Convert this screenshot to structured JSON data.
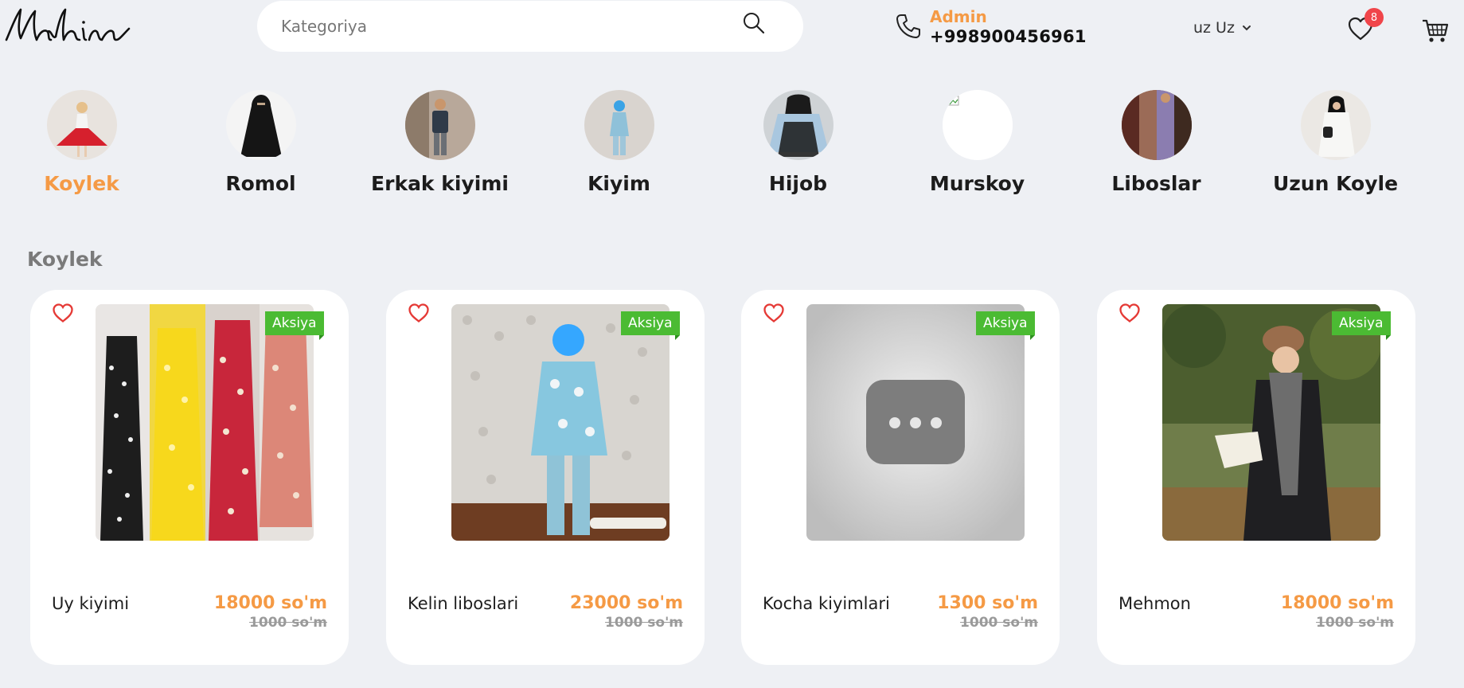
{
  "header": {
    "logo_text": "Mahina",
    "search_placeholder": "Kategoriya",
    "contact_name": "Admin",
    "contact_phone": "+998900456961",
    "language": "uz Uz",
    "favorites_count": "8",
    "accent_color": "#f59a45"
  },
  "categories": [
    {
      "label": "Koylek",
      "active": true
    },
    {
      "label": "Romol"
    },
    {
      "label": "Erkak kiyimi"
    },
    {
      "label": "Kiyim"
    },
    {
      "label": "Hijob"
    },
    {
      "label": "Murskoy"
    },
    {
      "label": "Liboslar"
    },
    {
      "label": "Uzun Koyle"
    }
  ],
  "section": {
    "title": "Koylek"
  },
  "products": [
    {
      "name": "Uy kiyimi",
      "price": "18000 so'm",
      "old_price": "1000 so'm",
      "badge": "Aksiya"
    },
    {
      "name": "Kelin liboslari",
      "price": "23000 so'm",
      "old_price": "1000 so'm",
      "badge": "Aksiya"
    },
    {
      "name": "Kocha kiyimlari",
      "price": "1300 so'm",
      "old_price": "1000 so'm",
      "badge": "Aksiya"
    },
    {
      "name": "Mehmon",
      "price": "18000 so'm",
      "old_price": "1000 so'm",
      "badge": "Aksiya"
    }
  ],
  "colors": {
    "badge_green": "#4bbb33",
    "badge_red": "#f0454a",
    "heart_red": "#e53935"
  }
}
